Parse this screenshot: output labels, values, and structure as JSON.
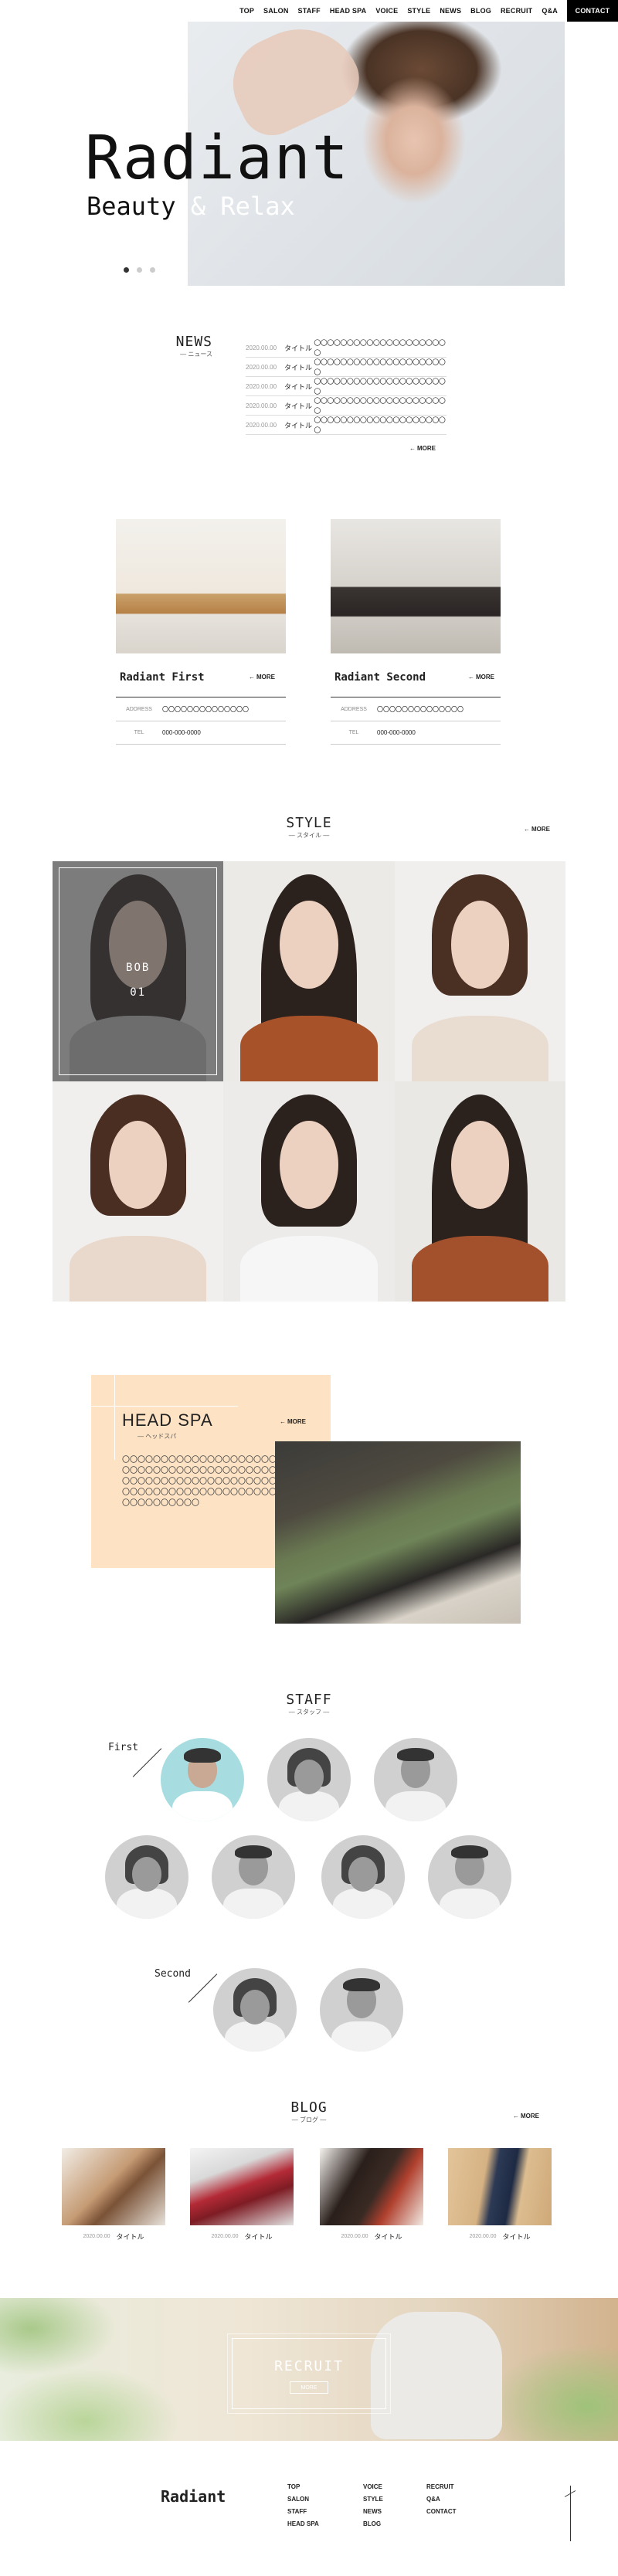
{
  "nav": {
    "items": [
      "TOP",
      "SALON",
      "STAFF",
      "HEAD SPA",
      "VOICE",
      "STYLE",
      "NEWS",
      "BLOG",
      "RECRUIT",
      "Q&A"
    ],
    "contact": "CONTACT"
  },
  "hero": {
    "title": "Radiant",
    "subtitle_a": "Beauty",
    "subtitle_amp": "& Relax",
    "slide_count": 3,
    "active_slide": 1
  },
  "news": {
    "title": "NEWS",
    "sub": "— ニュース",
    "rows": [
      {
        "date": "2020.00.00",
        "title": "タイトル",
        "body": "〇〇〇〇〇〇〇〇〇〇〇〇〇〇〇〇〇〇〇〇〇"
      },
      {
        "date": "2020.00.00",
        "title": "タイトル",
        "body": "〇〇〇〇〇〇〇〇〇〇〇〇〇〇〇〇〇〇〇〇〇"
      },
      {
        "date": "2020.00.00",
        "title": "タイトル",
        "body": "〇〇〇〇〇〇〇〇〇〇〇〇〇〇〇〇〇〇〇〇〇"
      },
      {
        "date": "2020.00.00",
        "title": "タイトル",
        "body": "〇〇〇〇〇〇〇〇〇〇〇〇〇〇〇〇〇〇〇〇〇"
      },
      {
        "date": "2020.00.00",
        "title": "タイトル",
        "body": "〇〇〇〇〇〇〇〇〇〇〇〇〇〇〇〇〇〇〇〇〇"
      }
    ],
    "more": "MORE"
  },
  "salons": [
    {
      "name": "Radiant First",
      "more": "MORE",
      "address_key": "ADDRESS",
      "address": "〇〇〇〇〇〇〇〇〇〇〇〇〇〇",
      "tel_key": "TEL",
      "tel": "000-000-0000"
    },
    {
      "name": "Radiant Second",
      "more": "MORE",
      "address_key": "ADDRESS",
      "address": "〇〇〇〇〇〇〇〇〇〇〇〇〇〇",
      "tel_key": "TEL",
      "tel": "000-000-0000"
    }
  ],
  "style": {
    "title": "STYLE",
    "sub": "— スタイル —",
    "more": "MORE",
    "overlay_label": "BOB",
    "overlay_num": "01"
  },
  "headspa": {
    "title": "HEAD SPA",
    "sub": "— ヘッドスパ",
    "more": "MORE",
    "body_lines": [
      "〇〇〇〇〇〇〇〇〇〇〇〇〇〇〇〇〇〇〇〇",
      "〇〇〇〇〇〇〇〇〇〇〇〇〇〇〇〇〇〇〇〇",
      "〇〇〇〇〇〇〇〇〇〇〇〇〇〇〇〇〇〇〇〇",
      "〇〇〇〇〇〇〇〇〇〇〇〇〇〇〇〇〇〇〇〇",
      "〇〇〇〇〇〇〇〇〇〇"
    ]
  },
  "staff": {
    "title": "STAFF",
    "sub": "— スタッフ —",
    "first_label": "First",
    "second_label": "Second"
  },
  "blog": {
    "title": "BLOG",
    "sub": "— ブログ —",
    "more": "MORE",
    "posts": [
      {
        "date": "2020.00.00",
        "title": "タイトル"
      },
      {
        "date": "2020.00.00",
        "title": "タイトル"
      },
      {
        "date": "2020.00.00",
        "title": "タイトル"
      },
      {
        "date": "2020.00.00",
        "title": "タイトル"
      }
    ]
  },
  "recruit": {
    "title": "RECRUIT",
    "more": "MORE"
  },
  "footer": {
    "logo": "Radiant",
    "col1": [
      "TOP",
      "SALON",
      "STAFF",
      "HEAD SPA"
    ],
    "col2": [
      "VOICE",
      "STYLE",
      "NEWS",
      "BLOG"
    ],
    "col3": [
      "RECRUIT",
      "Q&A",
      "CONTACT"
    ]
  },
  "colors": {
    "accent_peach": "#fde2c3",
    "first_staff_bg": "#a7dde0",
    "contact_bg": "#000000"
  }
}
